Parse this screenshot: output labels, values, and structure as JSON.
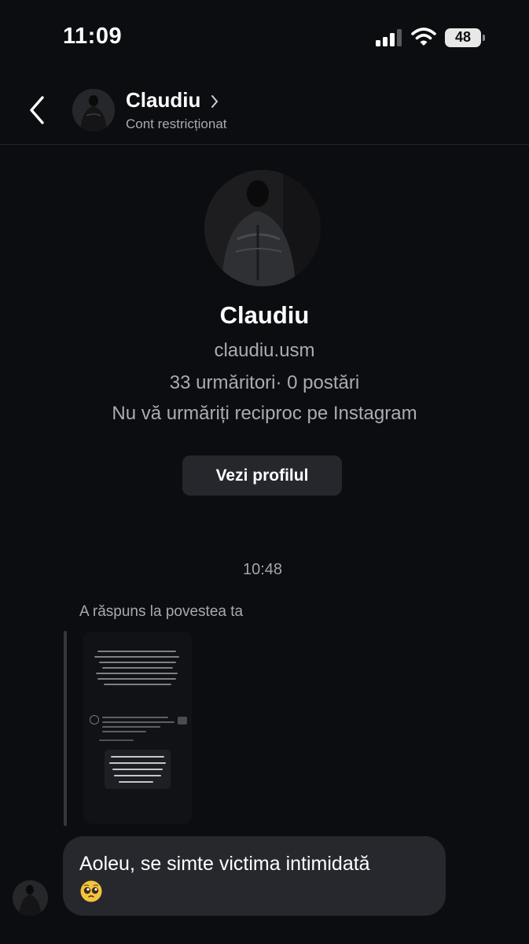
{
  "status_bar": {
    "time": "11:09",
    "battery": "48",
    "icons": [
      "signal-icon",
      "wifi-icon",
      "battery-icon"
    ]
  },
  "header": {
    "back_icon": "chevron-left-icon",
    "name": "Claudiu",
    "subtitle": "Cont restricționat",
    "chevron_icon": "chevron-right-icon"
  },
  "profile": {
    "name": "Claudiu",
    "username": "claudiu.usm",
    "stats": "33 urmăritori· 0 postări",
    "mutual": "Nu vă urmăriți reciproc pe Instagram",
    "view_profile_label": "Vezi profilul"
  },
  "conversation": {
    "timestamp": "10:48",
    "story_reply_label": "A răspuns la povestea ta",
    "message": {
      "text": "Aoleu, se simte victima intimidată",
      "emoji": "pleading-face-icon"
    }
  },
  "colors": {
    "background": "#0c0d10",
    "bubble": "#26282e",
    "button": "#25272d",
    "secondary_text": "#a9acb3"
  }
}
